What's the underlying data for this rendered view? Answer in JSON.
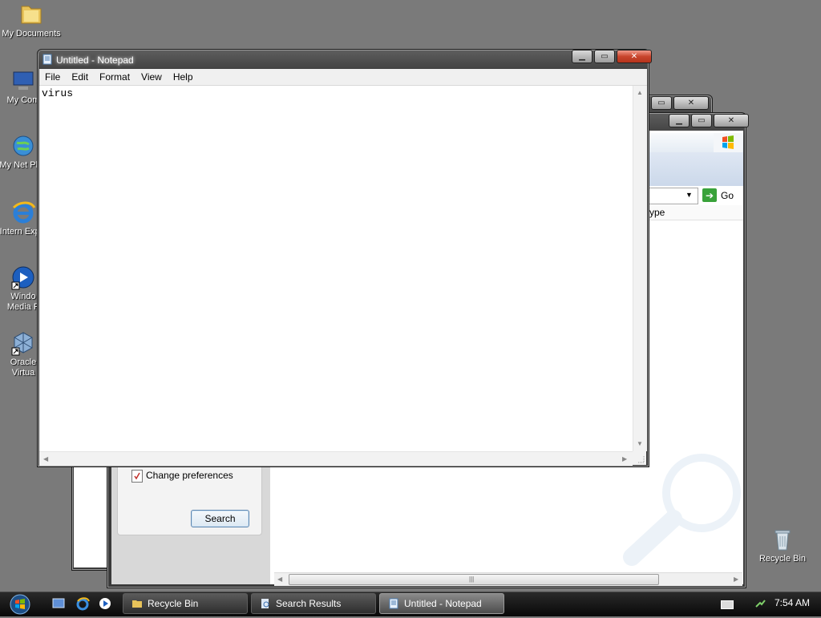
{
  "desktop": {
    "icons": [
      {
        "label": "My Documents"
      },
      {
        "label": "My Com"
      },
      {
        "label": "My Net Plac"
      },
      {
        "label": "Intern Explo"
      },
      {
        "label": "Windo Media P"
      },
      {
        "label": "Oracle Virtua"
      }
    ],
    "recycle_bin_label": "Recycle Bin"
  },
  "notepad": {
    "title": "Untitled - Notepad",
    "menu": [
      "File",
      "Edit",
      "Format",
      "View",
      "Help"
    ],
    "text": "virus"
  },
  "search_window": {
    "go_label": "Go",
    "type_header": "ype",
    "change_preferences": "Change preferences",
    "search_button": "Search"
  },
  "taskbar": {
    "tasks": [
      {
        "label": "Recycle Bin",
        "active": false
      },
      {
        "label": "Search Results",
        "active": false
      },
      {
        "label": "Untitled - Notepad",
        "active": true
      }
    ],
    "clock": "7:54 AM"
  },
  "colors": {
    "desktop": "#7a7a7a",
    "taskbar": "#0f0f0f",
    "close_active": "#c8452d",
    "go_green": "#39a23a"
  }
}
